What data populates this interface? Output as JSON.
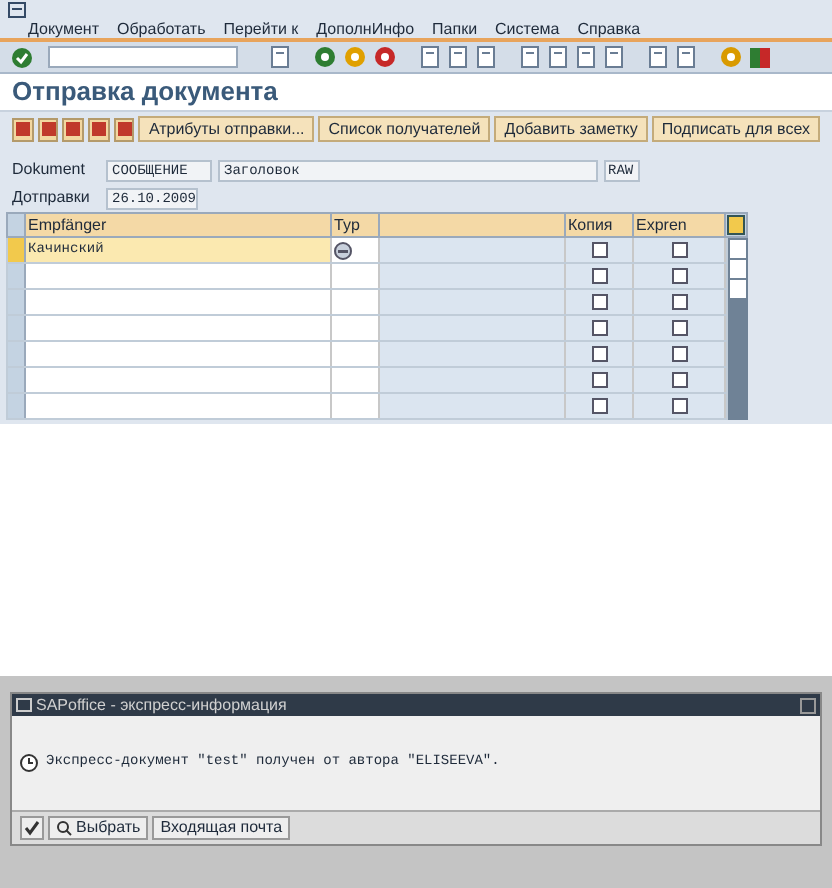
{
  "menu": [
    "Документ",
    "Обработать",
    "Перейти к",
    "ДополнИнфо",
    "Папки",
    "Система",
    "Справка"
  ],
  "title": "Отправка документа",
  "app_toolbar": [
    "Атрибуты отправки...",
    "Список получателей",
    "Добавить заметку",
    "Подписать для всех"
  ],
  "fields": {
    "document_label": "Dokument",
    "document_type": "СООБЩЕНИЕ",
    "document_title": "Заголовок",
    "document_format": "RAW",
    "date_label": "Дотправки",
    "date": "26.10.2009"
  },
  "table": {
    "columns": [
      "Empfänger",
      "Typ",
      "Копия",
      "Expren"
    ],
    "rows": [
      {
        "recipient": "Качинский",
        "type_icon": true,
        "selected": true,
        "copy": false,
        "express": false
      },
      {
        "type_icon": false,
        "selected": false,
        "copy": false,
        "express": false
      },
      {
        "type_icon": false,
        "selected": false,
        "copy": false,
        "express": false
      },
      {
        "type_icon": false,
        "selected": false,
        "copy": false,
        "express": false
      },
      {
        "type_icon": false,
        "selected": false,
        "copy": false,
        "express": false
      },
      {
        "type_icon": false,
        "selected": false,
        "copy": false,
        "express": false
      },
      {
        "type_icon": false,
        "selected": false,
        "copy": false,
        "express": false
      }
    ]
  },
  "dialog": {
    "title": "SAPoffice - экспресс-информация",
    "message": "Экспресс-документ \"test\" получен от автора \"ELISEEVA\".",
    "buttons": [
      "Выбрать",
      "Входящая почта"
    ]
  }
}
